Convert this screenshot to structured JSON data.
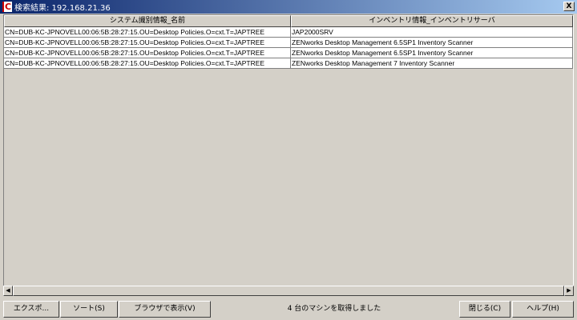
{
  "window": {
    "title": "検索結果: 192.168.21.36",
    "icon": "app-c-icon",
    "close_label": "X"
  },
  "table": {
    "columns": [
      "システム識別情報_名前",
      "インベントリ情報_インベントリサーバ"
    ],
    "rows": [
      [
        "CN=DUB-KC-JPNOVELL00:06:5B:28:27:15.OU=Desktop Policies.O=cxt.T=JAPTREE",
        "JAP2000SRV"
      ],
      [
        "CN=DUB-KC-JPNOVELL00:06:5B:28:27:15.OU=Desktop Policies.O=cxt.T=JAPTREE",
        "ZENworks Desktop Management 6.5SP1 Inventory Scanner"
      ],
      [
        "CN=DUB-KC-JPNOVELL00:06:5B:28:27:15.OU=Desktop Policies.O=cxt.T=JAPTREE",
        "ZENworks Desktop Management 6.5SP1 Inventory Scanner"
      ],
      [
        "CN=DUB-KC-JPNOVELL00:06:5B:28:27:15.OU=Desktop Policies.O=cxt.T=JAPTREE",
        "ZENworks Desktop Management 7 Inventory Scanner"
      ]
    ]
  },
  "buttons": {
    "export": "エクスポ...",
    "sort": "ソート(S)",
    "browser": "ブラウザで表示(V)",
    "close": "閉じる(C)",
    "help": "ヘルプ(H)"
  },
  "status": "4 台のマシンを取得しました"
}
